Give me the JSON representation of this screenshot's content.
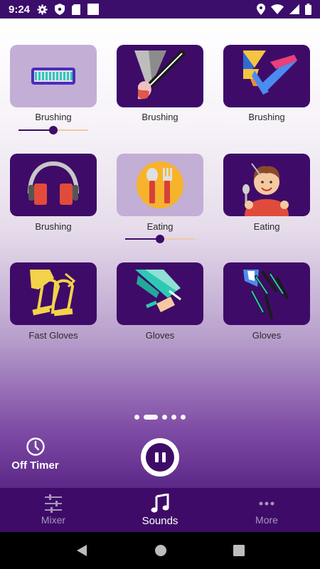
{
  "status_bar": {
    "time": "9:24"
  },
  "tiles": [
    {
      "label": "Brushing",
      "icon": "comb-icon",
      "active": true,
      "volume": 0.5
    },
    {
      "label": "Brushing",
      "icon": "paintbrush-icon",
      "active": false
    },
    {
      "label": "Brushing",
      "icon": "colorful-brush-icon",
      "active": false
    },
    {
      "label": "Brushing",
      "icon": "headphones-icon",
      "active": false
    },
    {
      "label": "Eating",
      "icon": "fork-spoon-icon",
      "active": true,
      "volume": 0.5
    },
    {
      "label": "Eating",
      "icon": "boy-eating-icon",
      "active": false
    },
    {
      "label": "Fast Gloves",
      "icon": "gloves-icon",
      "active": false
    },
    {
      "label": "Gloves",
      "icon": "teal-gloves-icon",
      "active": false
    },
    {
      "label": "Gloves",
      "icon": "dark-gloves-icon",
      "active": false
    }
  ],
  "pager": {
    "pages": 5,
    "current": 2
  },
  "timer": {
    "label": "Off Timer"
  },
  "nav": [
    {
      "label": "Mixer",
      "icon": "sliders-icon",
      "active": false
    },
    {
      "label": "Sounds",
      "icon": "music-note-icon",
      "active": true
    },
    {
      "label": "More",
      "icon": "dots-icon",
      "active": false
    }
  ],
  "colors": {
    "primary": "#3e0c68",
    "active_tile": "#c3aed6",
    "accent_track": "#f0c9a5"
  }
}
